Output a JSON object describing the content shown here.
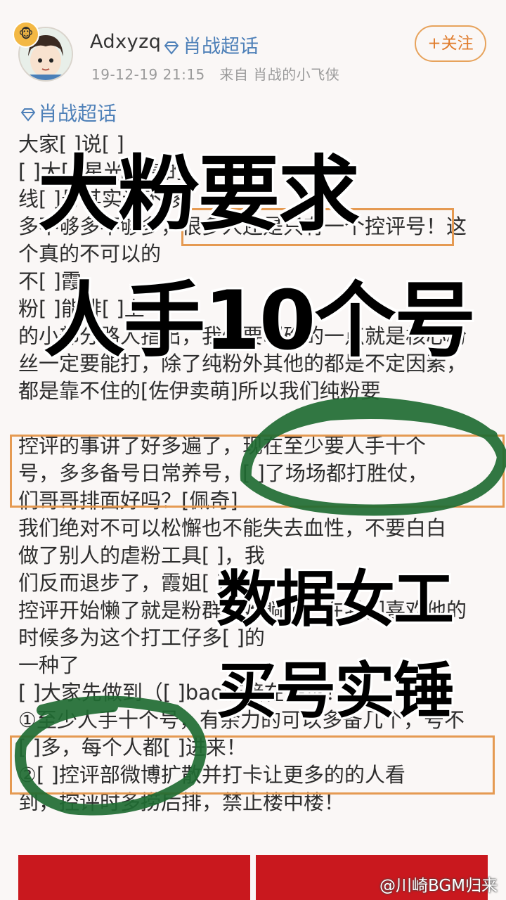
{
  "post_header": {
    "username": "Adxyzq",
    "topic_tag": "肖战超话",
    "timestamp": "19-12-19 21:15",
    "source": "来自 肖战的小飞侠",
    "follow_label": "+关注",
    "badge_icon": "monkey-badge-icon"
  },
  "topic_line": "肖战超话",
  "post_lines": [
    "大家[  ]说[  ]",
    "[  ]大[  ]星光大赏的",
    "线[  ]号其实还不够",
    "多不够多不够多，很多人还是只有一个控评号！这",
    "个真的不可以的",
    "不[  ]霞",
    "粉[  ]能排[  ]上",
    "的小部分路人指出，我们要明确的一点就是核心粉",
    "丝一定要能打，除了纯粉外其他的都是不定因素，",
    "都是靠不住的[佐伊卖萌]所以我们纯粉要",
    "",
    "控评的事讲了好多遍了，现在至少要人手十个",
    "号，多多备号日常养号，[  ]了场场都打胜仗，",
    "们哥哥排面好吗？[佩奇]",
    "我们绝对不可以松懈也不能失去血性，不要白白",
    "做了别人的虐粉工具[  ]，我",
    "们反而退步了，霞姐[  ]",
    "控评开始懒了就是粉群开始躺了，在我们喜欢他的",
    "时候多为这个打工仔多[  ]的",
    "一种了",
    "[  ]大家先做到（[  ]bao链接在评论！）",
    "①至少人手十个号，有余力的可以多备几个，号不",
    "[  ]多，每个人都[  ]进来！",
    "②[  ]控评部微博扩散并打卡让更多的的人看",
    "到，控评时多捞后排，禁止楼中楼！"
  ],
  "overlay": {
    "line1": "大粉要求",
    "line2": "人手10个号",
    "line3": "数据女工",
    "line4": "买号实锤"
  },
  "watermark": "@川崎BGM归来",
  "colors": {
    "topic_blue": "#4e80b8",
    "highlight_orange": "#e59a52",
    "scribble_green": "#1f6b32",
    "bottom_red": "#c9181e"
  }
}
